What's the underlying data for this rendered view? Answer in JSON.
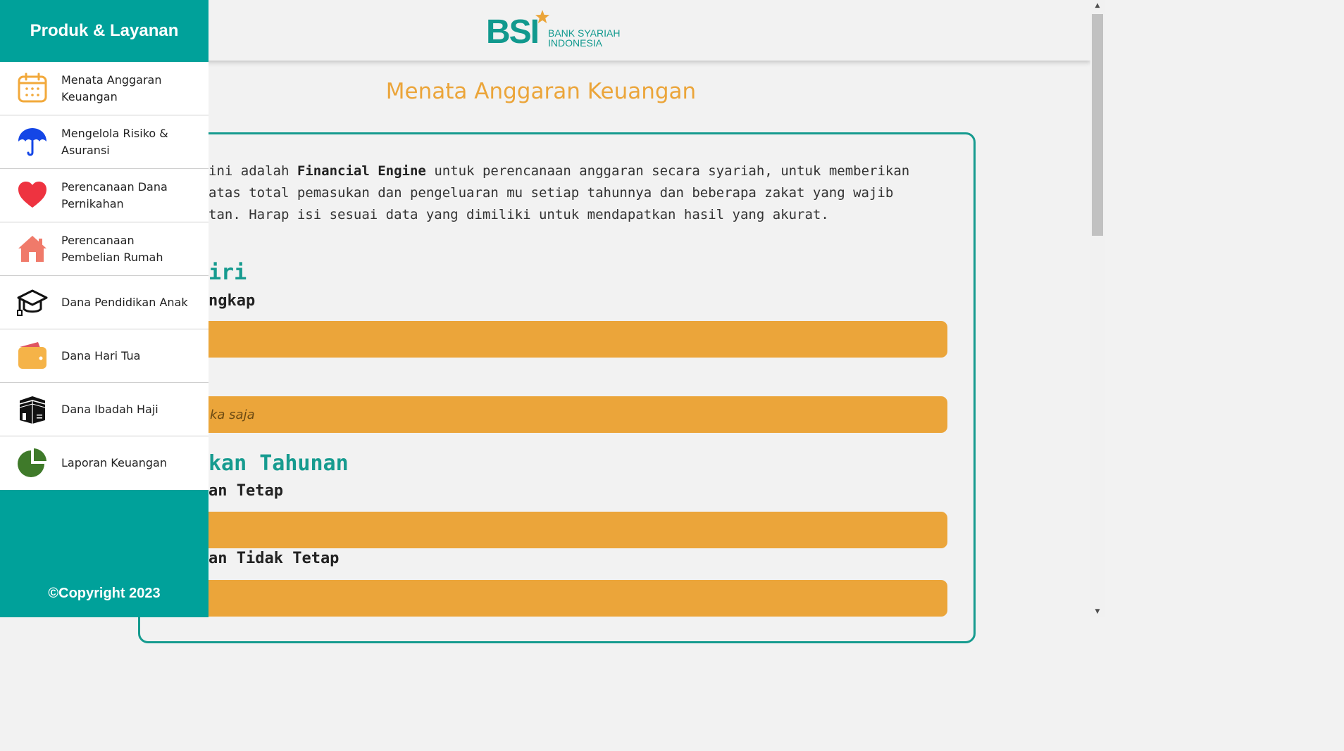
{
  "header": {
    "logo_text": "BSI",
    "logo_sub_line1": "BANK SYARIAH",
    "logo_sub_line2": "INDONESIA",
    "brand_color": "#11998e",
    "accent_color": "#eba53a"
  },
  "page": {
    "title": "Menata Anggaran Keuangan"
  },
  "intro": {
    "line1_prefix": "ini adalah ",
    "line1_bold": "Financial Engine",
    "line1_suffix": " untuk perencanaan anggaran secara syariah, untuk memberikan",
    "line2": "atas total pemasukan dan pengeluaran mu setiap tahunnya dan beberapa zakat yang wajib",
    "line3": "tan. Harap isi sesuai data yang dimiliki untuk mendapatkan hasil yang akurat."
  },
  "form": {
    "section1_title": "iri",
    "field1_label": "ngkap",
    "field1_value": "",
    "field2_placeholder": "ka saja",
    "section2_title": "kan Tahunan",
    "field3_label": "an Tetap",
    "field3_value": "",
    "field4_label": "an Tidak Tetap",
    "field4_value": ""
  },
  "sidebar": {
    "title": "Produk & Layanan",
    "items": [
      {
        "label": "Menata Anggaran Keuangan",
        "icon": "calendar-icon"
      },
      {
        "label": "Mengelola Risiko & Asuransi",
        "icon": "umbrella-icon"
      },
      {
        "label": "Perencanaan Dana Pernikahan",
        "icon": "heart-icon"
      },
      {
        "label": "Perencanaan Pembelian Rumah",
        "icon": "house-icon"
      },
      {
        "label": "Dana Pendidikan Anak",
        "icon": "graduation-cap-icon"
      },
      {
        "label": "Dana Hari Tua",
        "icon": "wallet-icon"
      },
      {
        "label": "Dana Ibadah Haji",
        "icon": "kaaba-icon"
      },
      {
        "label": "Laporan Keuangan",
        "icon": "pie-chart-icon"
      }
    ],
    "copyright": "©Copyright 2023",
    "bg_color": "#00a19a"
  }
}
